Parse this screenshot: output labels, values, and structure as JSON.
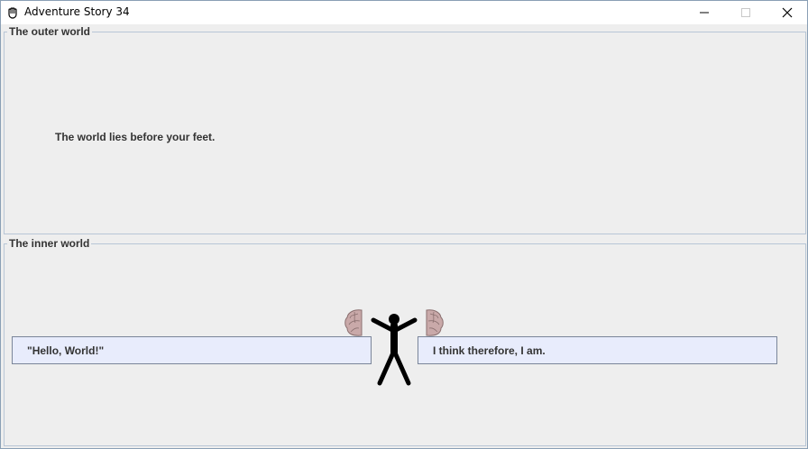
{
  "window": {
    "title": "Adventure Story 34",
    "icon": "hand-icon",
    "controls": [
      "minimize-icon",
      "maximize-icon",
      "close-icon"
    ]
  },
  "outer_panel": {
    "legend": "The outer world",
    "message": "The world lies before your feet."
  },
  "inner_panel": {
    "legend": "The inner world",
    "speech_value": "\"Hello, World!\"",
    "thought_value": "I think therefore, I am."
  },
  "colors": {
    "window_bg": "#eeeeee",
    "field_bg": "#e8ecfc",
    "panel_border": "#b8c6d6"
  }
}
